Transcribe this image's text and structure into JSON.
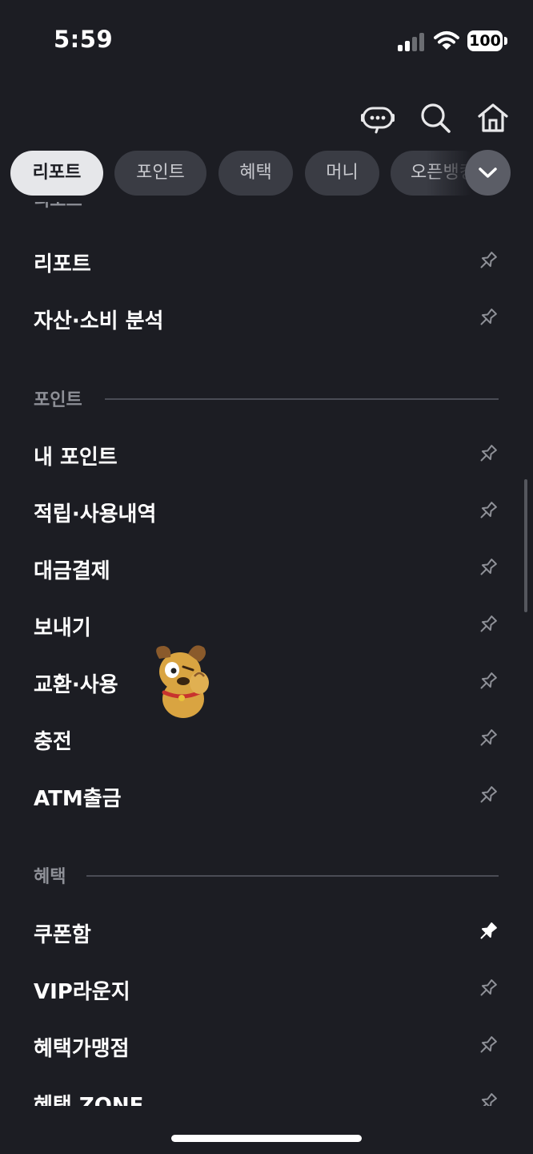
{
  "status_bar": {
    "time": "5:59",
    "battery": "100"
  },
  "top_bar": {
    "icons": [
      "chatbot-icon",
      "search-icon",
      "home-icon"
    ]
  },
  "tabs": [
    {
      "label": "리포트",
      "active": true
    },
    {
      "label": "포인트",
      "active": false
    },
    {
      "label": "혜택",
      "active": false
    },
    {
      "label": "머니",
      "active": false
    },
    {
      "label": "오픈뱅킹",
      "active": false
    }
  ],
  "menu": {
    "partial_section_title": "리포트",
    "report_items": [
      {
        "label": "리포트",
        "pinned": false
      },
      {
        "label": "자산·소비 분석",
        "pinned": false
      }
    ],
    "point_section": {
      "title": "포인트",
      "items": [
        {
          "label": "내 포인트",
          "pinned": false
        },
        {
          "label": "적립·사용내역",
          "pinned": false
        },
        {
          "label": "대금결제",
          "pinned": false
        },
        {
          "label": "보내기",
          "pinned": false
        },
        {
          "label": "교환·사용",
          "pinned": false
        },
        {
          "label": "충전",
          "pinned": false
        },
        {
          "label": "ATM출금",
          "pinned": false
        }
      ]
    },
    "benefit_section": {
      "title": "혜택",
      "items": [
        {
          "label": "쿠폰함",
          "pinned": true
        },
        {
          "label": "VIP라운지",
          "pinned": false
        },
        {
          "label": "혜택가맹점",
          "pinned": false
        },
        {
          "label": "혜택 ZONE",
          "pinned": false
        }
      ]
    }
  },
  "colors": {
    "background": "#1c1d23",
    "chip": "#3a3c44",
    "active_chip": "#e6e7ea",
    "muted_text": "#8e9097"
  }
}
